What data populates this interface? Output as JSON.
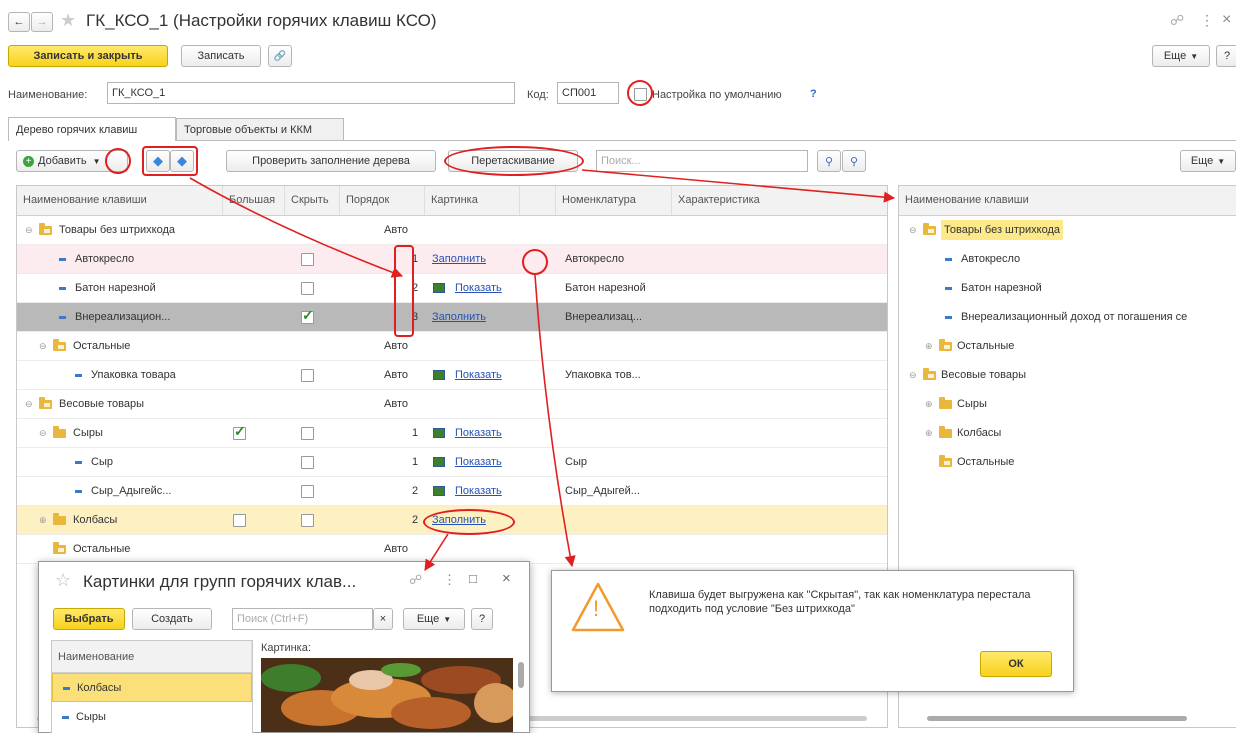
{
  "titlebar": {
    "back": "←",
    "forward": "→",
    "title": "ГК_КСО_1 (Настройки горячих клавиш КСО)",
    "link": "☍",
    "menu": "⋮",
    "close": "×"
  },
  "toolbar": {
    "save_close": "Записать и закрыть",
    "save": "Записать",
    "attach": "🔗",
    "more": "Еще",
    "help": "?"
  },
  "form": {
    "name_label": "Наименование:",
    "name_value": "ГК_КСО_1",
    "code_label": "Код:",
    "code_value": "СП001",
    "default_label": "Настройка по умолчанию",
    "default_help": "?"
  },
  "tabs": [
    "Дерево горячих клавиш",
    "Торговые объекты и ККМ"
  ],
  "tree_toolbar": {
    "add": "Добавить",
    "check": "Проверить заполнение дерева",
    "drag": "Перетаскивание",
    "search_placeholder": "Поиск...",
    "more": "Еще"
  },
  "columns": [
    "Наименование клавиши",
    "Большая",
    "Скрыть",
    "Порядок",
    "Картинка",
    "",
    "Номенклатура",
    "Характеристика"
  ],
  "rows": [
    {
      "name": "Товары без штрихкода",
      "order": "Авто",
      "pic": "",
      "nom": ""
    },
    {
      "name": "Автокресло",
      "order": "1",
      "pic": "Заполнить",
      "nom": "Автокресло"
    },
    {
      "name": "Батон нарезной",
      "order": "2",
      "pic": "Показать",
      "nom": "Батон нарезной"
    },
    {
      "name": "Внереализацион...",
      "order": "3",
      "pic": "Заполнить",
      "nom": "Внереализац..."
    },
    {
      "name": "Остальные",
      "order": "Авто",
      "pic": "",
      "nom": ""
    },
    {
      "name": "Упаковка товара",
      "order": "Авто",
      "pic": "Показать",
      "nom": "Упаковка тов..."
    },
    {
      "name": "Весовые товары",
      "order": "Авто",
      "pic": "",
      "nom": ""
    },
    {
      "name": "Сыры",
      "order": "1",
      "pic": "Показать",
      "nom": ""
    },
    {
      "name": "Сыр",
      "order": "1",
      "pic": "Показать",
      "nom": "Сыр"
    },
    {
      "name": "Сыр_Адыгейс...",
      "order": "2",
      "pic": "Показать",
      "nom": "Сыр_Адыгей..."
    },
    {
      "name": "Колбасы",
      "order": "2",
      "pic": "Заполнить",
      "nom": ""
    },
    {
      "name": "Остальные",
      "order": "Авто",
      "pic": "",
      "nom": ""
    }
  ],
  "right_panel": {
    "more": "Еще",
    "header": "Наименование клавиши",
    "items": [
      "Товары без штрихкода",
      "Автокресло",
      "Батон нарезной",
      "Внереализационный доход от погашения се",
      "Остальные",
      "Весовые товары",
      "Сыры",
      "Колбасы",
      "Остальные"
    ]
  },
  "popup": {
    "star": "☆",
    "title": "Картинки для групп горячих клав...",
    "link": "☍",
    "menu": "⋮",
    "max": "□",
    "close": "×",
    "choose": "Выбрать",
    "create": "Создать",
    "search_placeholder": "Поиск (Ctrl+F)",
    "clear": "×",
    "more": "Еще",
    "help": "?",
    "col_name": "Наименование",
    "pic_label": "Картинка:",
    "items": [
      "Колбасы",
      "Сыры"
    ]
  },
  "alert": {
    "message": "Клавиша будет выгружена как \"Скрытая\", так как номенклатура перестала подходить под условие \"Без штрихкода\"",
    "ok": "ОК",
    "icon": "!"
  },
  "colors": {
    "accent_yellow": "#f7d21d",
    "highlight_row": "#fdf1c4",
    "selected_row": "#b9b9b9",
    "pink_row": "#fdecef",
    "annotation_red": "#e02020"
  }
}
